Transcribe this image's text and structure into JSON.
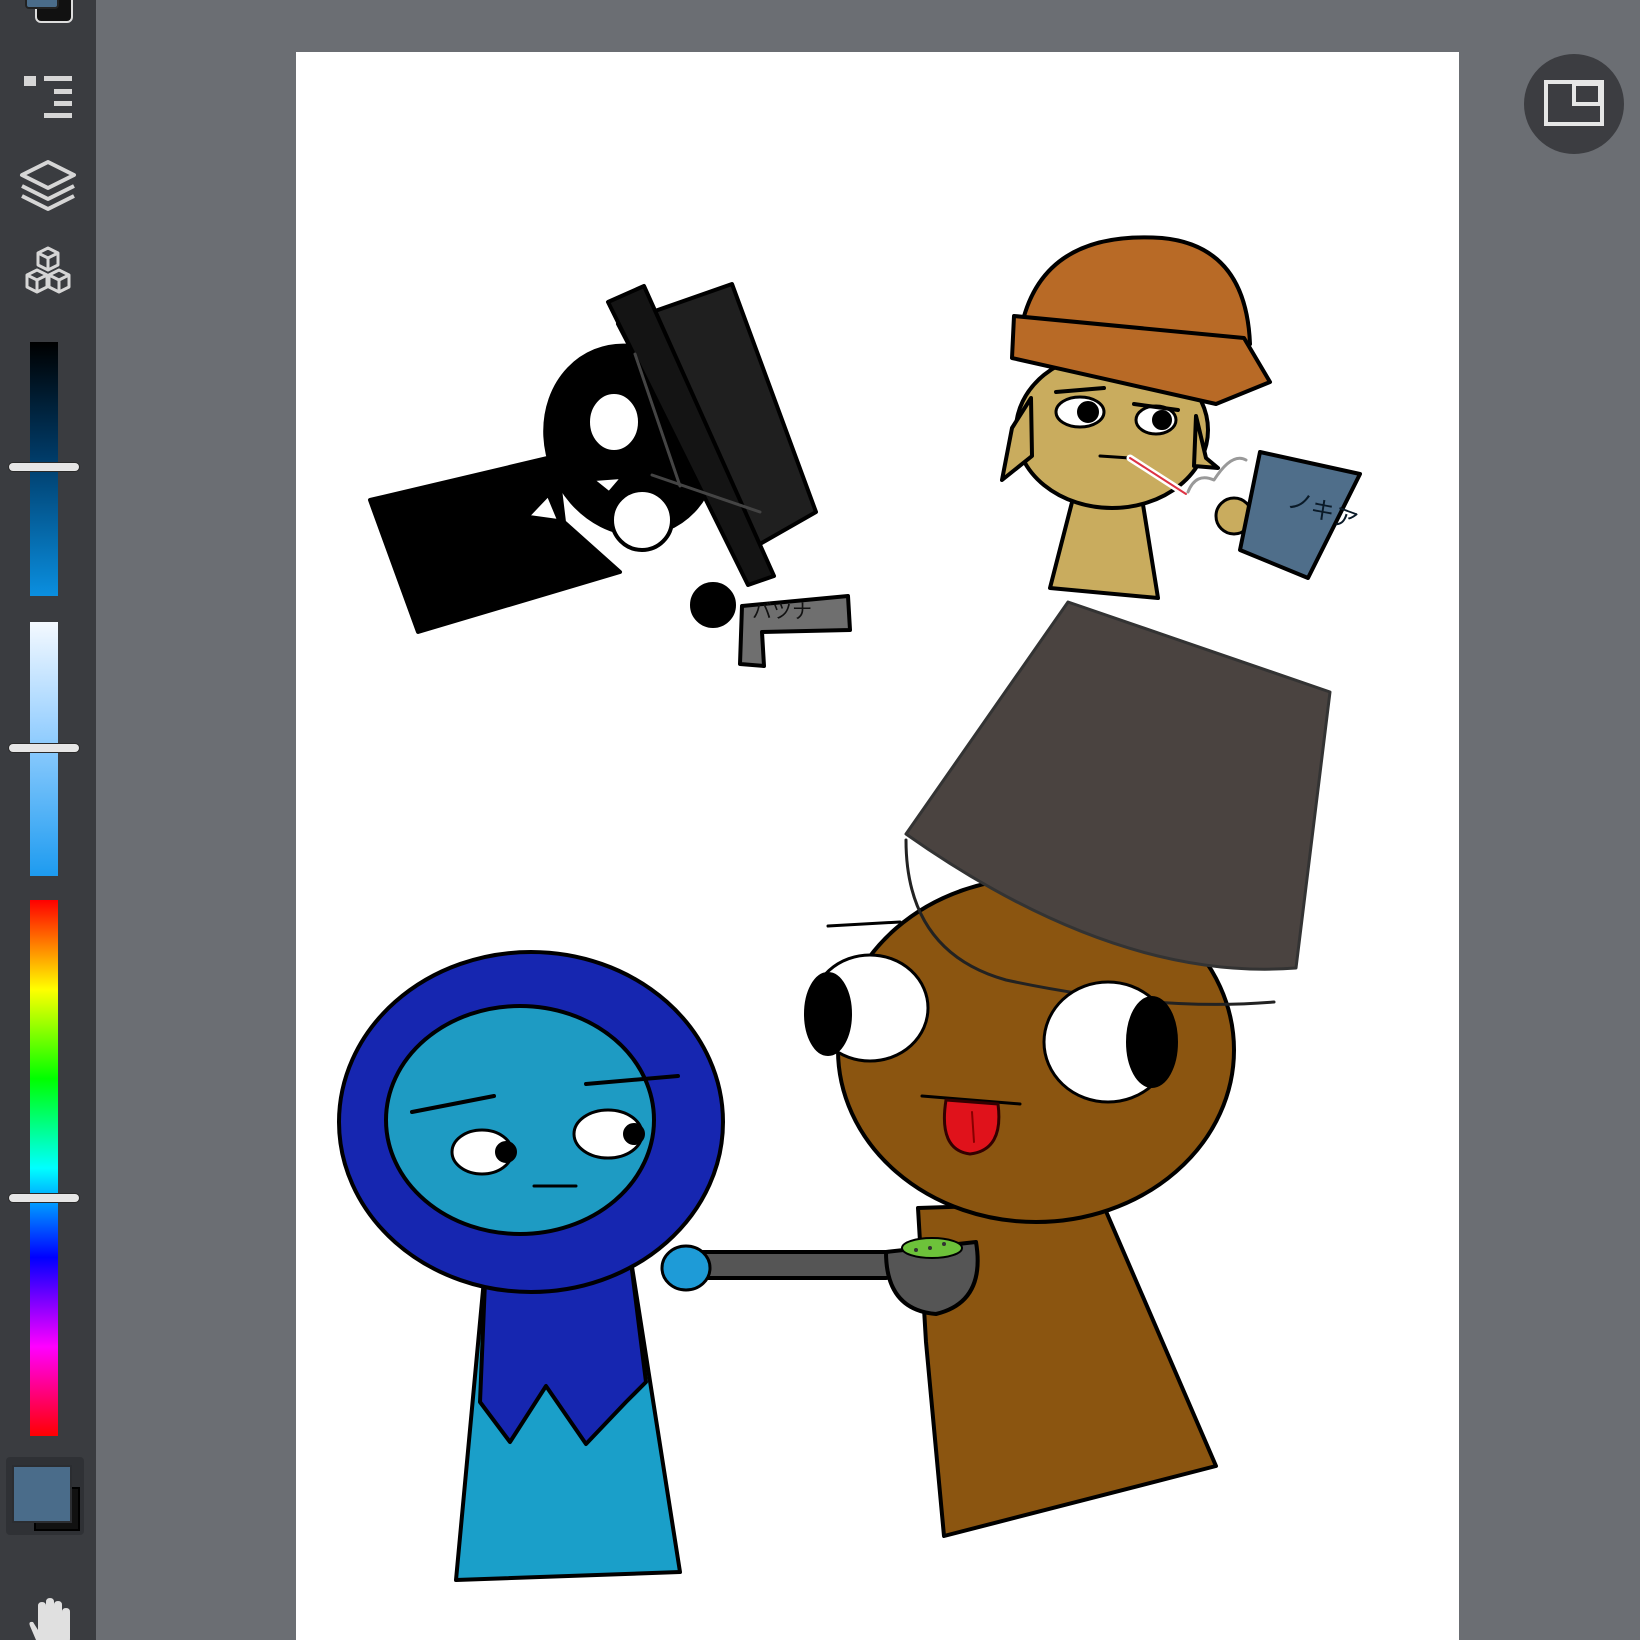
{
  "toolbar": {
    "icons": [
      "color-swatch-icon",
      "menu-list-icon",
      "layers-icon",
      "materials-cubes-icon",
      "hand-tool-icon"
    ],
    "sliders": {
      "hue_gradient_colors": [
        "#ff0000",
        "#ffff00",
        "#00ff00",
        "#00ffff",
        "#0000ff",
        "#ff00ff",
        "#ff0000"
      ],
      "hue_level": 0.56,
      "brightness_level": 0.5,
      "saturation_level": 0.49
    },
    "primary_color": "#4a6c8a",
    "secondary_color": "#111111"
  },
  "canvas": {
    "background": "#ffffff",
    "labels": {
      "katakana_tag_gray": "バツナ",
      "katakana_tag_blue": "ノキア"
    }
  },
  "view_toggle": {
    "icon": "window-mode-icon"
  }
}
